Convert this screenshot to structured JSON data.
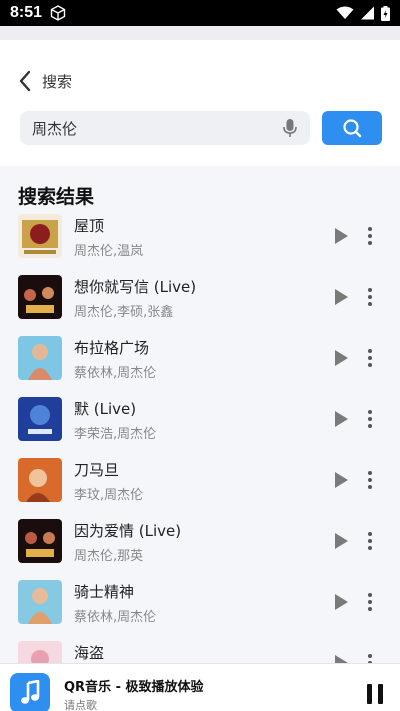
{
  "status": {
    "time": "8:51"
  },
  "header": {
    "back_title": "搜索"
  },
  "search": {
    "value": "周杰伦"
  },
  "results": {
    "title": "搜索结果",
    "songs": [
      {
        "name": "屋顶",
        "artist": "周杰伦,温岚"
      },
      {
        "name": "想你就写信 (Live)",
        "artist": "周杰伦,李硕,张鑫"
      },
      {
        "name": "布拉格广场",
        "artist": "蔡依林,周杰伦"
      },
      {
        "name": "默 (Live)",
        "artist": "李荣浩,周杰伦"
      },
      {
        "name": "刀马旦",
        "artist": "李玟,周杰伦"
      },
      {
        "name": "因为爱情 (Live)",
        "artist": "周杰伦,那英"
      },
      {
        "name": "骑士精神",
        "artist": "蔡依林,周杰伦"
      },
      {
        "name": "海盗",
        "artist": ""
      }
    ]
  },
  "player": {
    "title": "QR音乐 - 极致播放体验",
    "subtitle": "请点歌"
  },
  "colors": {
    "accent": "#2f8ff0",
    "icon_gray": "#7a7a7a"
  },
  "icons": [
    "box-icon",
    "wifi-icon",
    "signal-icon",
    "battery-icon",
    "back-icon",
    "mic-icon",
    "search-icon",
    "play-icon",
    "more-icon",
    "music-note-icon",
    "pause-icon"
  ]
}
